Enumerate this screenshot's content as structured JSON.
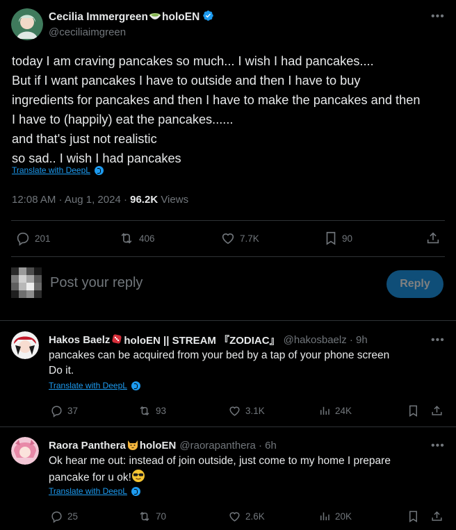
{
  "main_tweet": {
    "author_name": "Cecilia Immergreen",
    "author_org": "holoEN",
    "author_handle": "@ceciliaimgreen",
    "text_lines": [
      "today I am craving pancakes so much... I wish I had pancakes....",
      "But if I want pancakes I have to outside and then I have to buy",
      "ingredients for pancakes and then I have to make the pancakes and then",
      "I have to (happily) eat the pancakes......",
      "and that's just not realistic",
      "so sad.. I wish I had pancakes"
    ],
    "translate_label": "Translate with DeepL",
    "timestamp": "12:08 AM · Aug 1, 2024 · ",
    "views_count": "96.2K",
    "views_label": " Views",
    "stats": {
      "replies": "201",
      "reposts": "406",
      "likes": "7.7K",
      "bookmarks": "90"
    }
  },
  "reply_box": {
    "placeholder": "Post your reply",
    "button_label": "Reply"
  },
  "replies": [
    {
      "name": "Hakos Baelz",
      "name_suffix": "holoEN || STREAM 『ZODIAC』",
      "handle_time": "@hakosbaelz · 9h",
      "text_lines": [
        "pancakes can be acquired from your bed by a tap of your phone screen",
        "Do it."
      ],
      "translate_label": "Translate with DeepL",
      "replies": "37",
      "reposts": "93",
      "likes": "3.1K",
      "views": "24K"
    },
    {
      "name": "Raora Panthera",
      "name_suffix": "holoEN",
      "handle_time": "@raorapanthera · 6h",
      "text_lines": [
        "Ok hear me out: instead  of join outside, just come to my home I prepare",
        "pancake for u ok!"
      ],
      "translate_label": "Translate with DeepL",
      "replies": "25",
      "reposts": "70",
      "likes": "2.6K",
      "views": "20K"
    }
  ],
  "icons": {
    "more": "more-icon",
    "reply": "reply-icon",
    "repost": "repost-icon",
    "like": "heart-icon",
    "bookmark": "bookmark-icon",
    "share": "share-icon",
    "views": "views-icon",
    "verified": "verified-badge-icon",
    "deepl": "deepl-icon"
  },
  "colors": {
    "background": "#000000",
    "text": "#e7e9ea",
    "muted": "#71767b",
    "accent": "#1d9bf0",
    "divider": "#2f3336"
  }
}
